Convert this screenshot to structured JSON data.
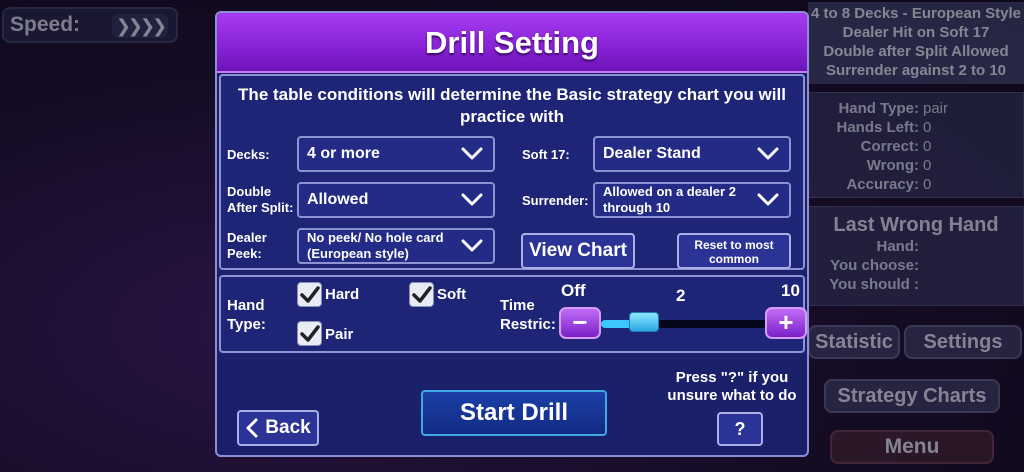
{
  "background": {
    "speed_label": "Speed:",
    "speed_arrows": "❯❯❯❯",
    "rules": [
      "4 to 8 Decks - European Style",
      "Dealer Hit on Soft 17",
      "Double after Split Allowed",
      "Surrender against 2 to 10"
    ],
    "stats": [
      {
        "label": "Hand Type:",
        "value": "pair"
      },
      {
        "label": "Hands Left:",
        "value": "0"
      },
      {
        "label": "Correct:",
        "value": "0"
      },
      {
        "label": "Wrong:",
        "value": "0"
      },
      {
        "label": "Accuracy:",
        "value": "0"
      }
    ],
    "last_wrong_hand": {
      "title": "Last Wrong Hand",
      "rows": [
        {
          "label": "Hand:",
          "value": ""
        },
        {
          "label": "You choose:",
          "value": ""
        },
        {
          "label": "You should :",
          "value": ""
        }
      ]
    },
    "buttons": {
      "statistic": "Statistic",
      "settings": "Settings",
      "strategy_charts": "Strategy Charts",
      "menu": "Menu"
    }
  },
  "dialog": {
    "title": "Drill Setting",
    "conditions_note": "The table conditions will determine the Basic strategy chart you will practice with",
    "fields": {
      "decks": {
        "label": "Decks:",
        "value": "4 or more"
      },
      "soft17": {
        "label": "Soft 17:",
        "value": "Dealer Stand"
      },
      "das": {
        "label_line1": "Double",
        "label_line2": "After Split:",
        "value": "Allowed"
      },
      "surrender": {
        "label": "Surrender:",
        "value_line1": "Allowed on a dealer 2",
        "value_line2": "through 10"
      },
      "peek": {
        "label_line1": "Dealer",
        "label_line2": "Peek:",
        "value_line1": "No peek/ No hole card",
        "value_line2": "(European style)"
      }
    },
    "view_chart": "View Chart",
    "reset_line1": "Reset to most",
    "reset_line2": "common",
    "hand_type": {
      "label_line1": "Hand",
      "label_line2": "Type:",
      "options": [
        {
          "name": "Hard",
          "checked": true
        },
        {
          "name": "Soft",
          "checked": true
        },
        {
          "name": "Pair",
          "checked": true
        }
      ]
    },
    "time_restriction": {
      "label_line1": "Time",
      "label_line2": "Restric:",
      "min_label": "Off",
      "value": "2",
      "max_label": "10",
      "level": 0.2,
      "minus": "−",
      "plus": "+"
    },
    "back_label": "Back",
    "start_label": "Start Drill",
    "help_text_line1": "Press \"?\" if you",
    "help_text_line2": "unsure what to do",
    "help_label": "?"
  },
  "colors": {
    "header_purple": "#8a24d8",
    "dialog_blue": "#1a2069",
    "accent_cyan": "#3cc6ff"
  }
}
